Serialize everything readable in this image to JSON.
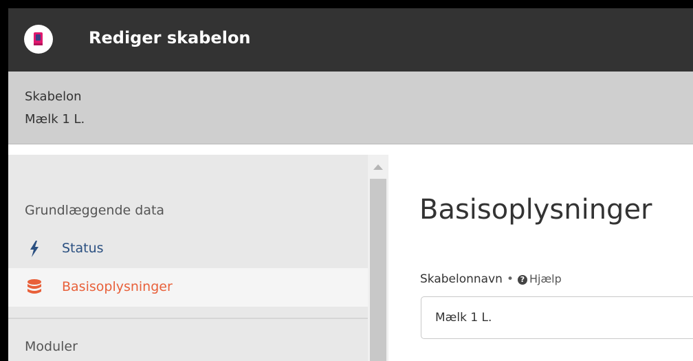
{
  "header": {
    "title": "Rediger skabelon"
  },
  "subheader": {
    "label": "Skabelon",
    "value": "Mælk 1 L."
  },
  "sidebar": {
    "sections": [
      {
        "title": "Grundlæggende data",
        "items": [
          {
            "label": "Status",
            "icon": "bolt-icon",
            "color": "#2a4f80",
            "active": false
          },
          {
            "label": "Basisoplysninger",
            "icon": "database-icon",
            "color": "#e8603a",
            "active": true
          }
        ]
      },
      {
        "title": "Moduler"
      }
    ]
  },
  "main": {
    "title": "Basisoplysninger",
    "field": {
      "label": "Skabelonnavn",
      "separator": "•",
      "help_label": "Hjælp",
      "value": "Mælk 1 L."
    }
  }
}
